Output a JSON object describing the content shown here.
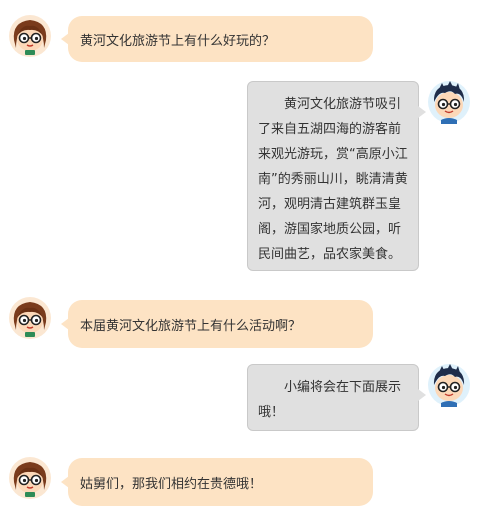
{
  "chat": {
    "messages": [
      {
        "sender": "girl",
        "text": "黄河文化旅游节上有什么好玩的？"
      },
      {
        "sender": "boy",
        "text": "黄河文化旅游节吸引了来自五湖四海的游客前来观光游玩，赏“高原小江南”的秀丽山川，眺清清黄河，观明清古建筑群玉皇阁，游国家地质公园，听民间曲艺，品农家美食。"
      },
      {
        "sender": "girl",
        "text": "本届黄河文化旅游节上有什么活动啊？"
      },
      {
        "sender": "boy",
        "text": "小编将会在下面展示哦！"
      },
      {
        "sender": "girl",
        "text": "姑舅们，那我们相约在贵德哦！"
      }
    ]
  },
  "avatars": {
    "girl_icon": "girl-with-glasses-icon",
    "boy_icon": "boy-with-glasses-icon"
  },
  "colors": {
    "left_bubble": "#fde3c4",
    "right_bubble": "#e0e0e0",
    "right_bubble_border": "#c9c9c9",
    "text": "#333333"
  }
}
